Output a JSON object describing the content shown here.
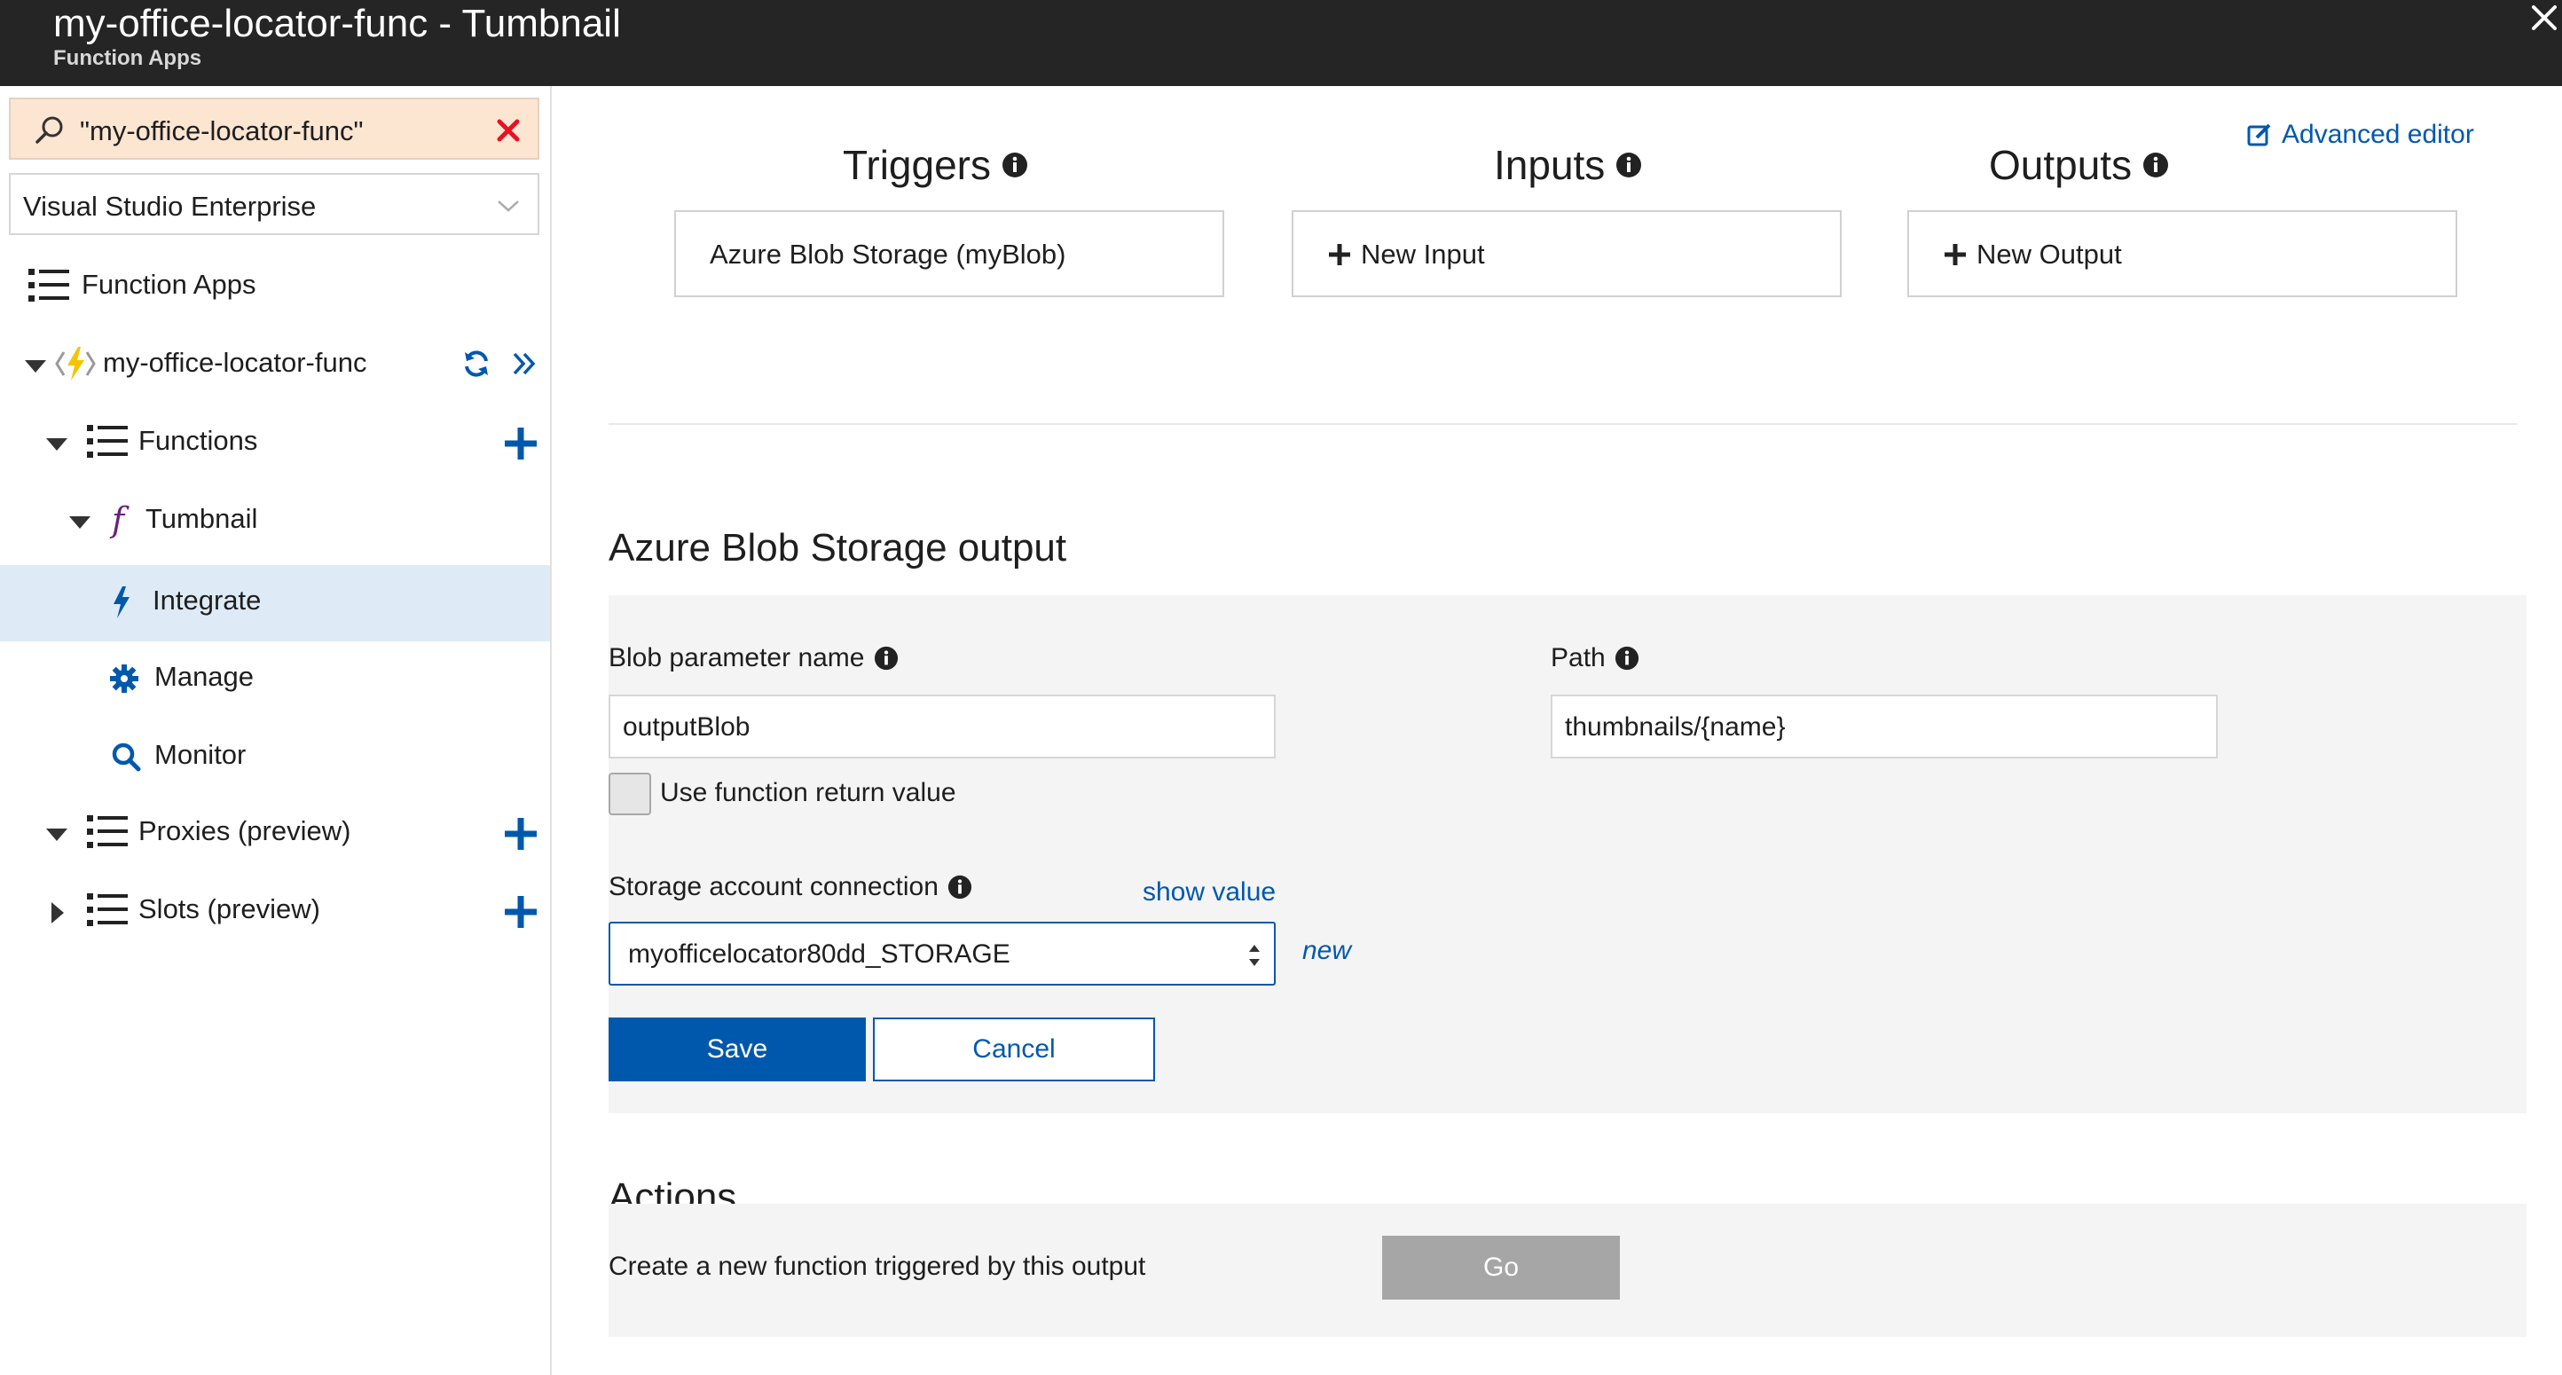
{
  "window": {
    "title": "my-office-locator-func - Tumbnail",
    "subtitle": "Function Apps",
    "close_icon": "close-icon"
  },
  "sidebar": {
    "search": {
      "value": "\"my-office-locator-func\"",
      "icon": "search-icon",
      "clear_icon": "clear-icon"
    },
    "subscription": {
      "value": "Visual Studio Enterprise"
    },
    "items": [
      {
        "label": "Function Apps",
        "icon": "list-icon"
      },
      {
        "label": "my-office-locator-func",
        "icon": "function-app-icon",
        "expanded": true
      },
      {
        "label": "Functions",
        "icon": "list-icon",
        "expanded": true
      },
      {
        "label": "Tumbnail",
        "icon": "function-icon",
        "expanded": true
      },
      {
        "label": "Integrate",
        "icon": "lightning-icon",
        "selected": true
      },
      {
        "label": "Manage",
        "icon": "gear-icon"
      },
      {
        "label": "Monitor",
        "icon": "search-icon"
      },
      {
        "label": "Proxies (preview)",
        "icon": "list-icon",
        "expanded": true
      },
      {
        "label": "Slots (preview)",
        "icon": "list-icon",
        "expanded": false
      }
    ]
  },
  "main": {
    "advanced_editor": "Advanced editor",
    "columns": [
      {
        "heading": "Triggers",
        "box": "Azure Blob Storage (myBlob)"
      },
      {
        "heading": "Inputs",
        "box": "New Input"
      },
      {
        "heading": "Outputs",
        "box": "New Output"
      }
    ],
    "output_section": {
      "title": "Azure Blob Storage output",
      "blob_param_label": "Blob parameter name",
      "blob_param_value": "outputBlob",
      "path_label": "Path",
      "path_value": "thumbnails/{name}",
      "use_return_label": "Use function return value",
      "use_return_checked": false,
      "storage_label": "Storage account connection",
      "show_value": "show value",
      "storage_value": "myofficelocator80dd_STORAGE",
      "new_link": "new",
      "save": "Save",
      "cancel": "Cancel"
    },
    "actions": {
      "title": "Actions",
      "description": "Create a new function triggered by this output",
      "go": "Go"
    }
  },
  "colors": {
    "accent": "#0058ad",
    "selected_bg": "#deebf7",
    "search_bg": "#fce5d1",
    "close_red": "#e81123",
    "titlebar": "#252526",
    "function_purple": "#68217a",
    "function_yellow": "#f5c400"
  }
}
